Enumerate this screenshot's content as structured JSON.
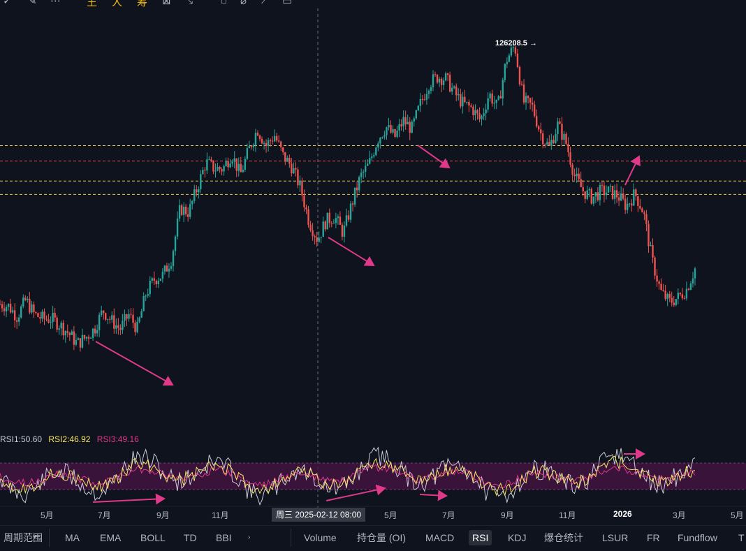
{
  "toolbar": {
    "items": [
      {
        "name": "pencil-icon",
        "glyph": "✓",
        "accent": false
      },
      {
        "name": "magic-icon",
        "glyph": "✎",
        "accent": false
      },
      {
        "name": "more-icon",
        "glyph": "⋯",
        "accent": false
      },
      {
        "name": "text-tool-1",
        "glyph": "王",
        "accent": true
      },
      {
        "name": "text-tool-2",
        "glyph": "人",
        "accent": true
      },
      {
        "name": "text-tool-3",
        "glyph": "筹",
        "accent": true
      },
      {
        "name": "calc-icon",
        "glyph": "⊠",
        "accent": false
      },
      {
        "name": "measure-icon",
        "glyph": "⤡",
        "accent": false
      },
      {
        "name": "magnet-icon",
        "glyph": "⌂",
        "accent": false
      },
      {
        "name": "eraser-icon",
        "glyph": "⌀",
        "accent": false
      },
      {
        "name": "ruler-icon",
        "glyph": "⟋",
        "accent": false
      },
      {
        "name": "trash-icon",
        "glyph": "▭",
        "accent": false
      }
    ]
  },
  "colors": {
    "up": "#26a69a",
    "down": "#ef5350",
    "background": "#0f131e",
    "annotation": "#e0398a",
    "hline_yellow": "#e6c34a",
    "hline_red": "#d9534f",
    "rsi1": "#c9ccd6",
    "rsi2": "#f5e663",
    "rsi3": "#e0398a",
    "rsi_band": "#4a1446"
  },
  "chart_data": [
    {
      "type": "candlestick",
      "title": "",
      "peak_label": "126208.5",
      "peak_value": 126208.5,
      "x_tick_labels": [
        "5月",
        "7月",
        "9月",
        "11月",
        "5月",
        "7月",
        "9月",
        "11月",
        "2026",
        "3月",
        "5月"
      ],
      "crosshair_label": "周三 2025-02-12 08:00",
      "horizontal_levels": [
        {
          "value": 102000,
          "color": "yellow"
        },
        {
          "value": 98300,
          "color": "red"
        },
        {
          "value": 93500,
          "color": "yellow"
        },
        {
          "value": 90300,
          "color": "yellow"
        }
      ],
      "series": [
        {
          "name": "close",
          "values": [
            64000,
            63500,
            61000,
            65000,
            61500,
            60500,
            60500,
            59000,
            57000,
            54500,
            56000,
            58000,
            62500,
            60000,
            58000,
            61500,
            58000,
            66500,
            70000,
            71000,
            75000,
            87000,
            86000,
            92000,
            98000,
            96500,
            96500,
            100000,
            95000,
            101000,
            106000,
            102000,
            104500,
            99500,
            97000,
            92000,
            84000,
            79500,
            84000,
            85000,
            81000,
            88000,
            94500,
            97500,
            103500,
            106500,
            104000,
            108000,
            106000,
            112000,
            117000,
            118500,
            118000,
            114500,
            112000,
            111000,
            108000,
            114500,
            111000,
            122500,
            126000,
            112500,
            111500,
            105000,
            101500,
            107000,
            102500,
            94500,
            91000,
            89500,
            91000,
            91000,
            90000,
            87500,
            90500,
            86000,
            74500,
            67000,
            64500,
            65500,
            67500,
            72500
          ]
        }
      ],
      "range_estimate": {
        "min": 49000,
        "max": 126208.5
      }
    },
    {
      "type": "line",
      "title": "",
      "legend": [
        {
          "label": "RSI1:50.60",
          "color": "rsi1"
        },
        {
          "label": "RSI2:46.92",
          "color": "rsi2"
        },
        {
          "label": "RSI3:49.16",
          "color": "rsi3"
        }
      ],
      "band": [
        30,
        70
      ],
      "last_values": {
        "RSI1": 50.6,
        "RSI2": 46.92,
        "RSI3": 49.16
      }
    }
  ],
  "bottom_tabs": {
    "left_label": "周期范围",
    "items": [
      "MA",
      "EMA",
      "BOLL",
      "TD",
      "BBI"
    ],
    "right_items": [
      "Volume",
      "持仓量 (OI)",
      "MACD",
      "RSI",
      "KDJ",
      "爆仓统计",
      "LSUR",
      "FR",
      "Fundflow",
      "T"
    ],
    "active": "RSI"
  }
}
